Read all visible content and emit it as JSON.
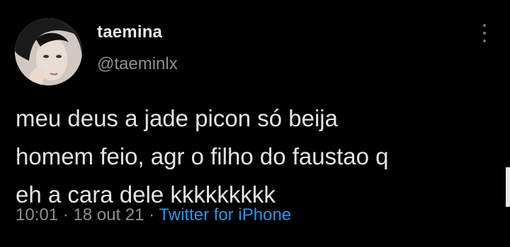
{
  "tweet": {
    "author": {
      "display_name": "taemina",
      "handle": "@taeminlx"
    },
    "text_lines": [
      "meu deus a jade picon só beija",
      "homem feio, agr o filho do faustao q",
      "eh a cara dele kkkkkkkkk"
    ],
    "time": "10:01",
    "date": "18 out 21",
    "separator": "·",
    "source": "Twitter for iPhone"
  },
  "colors": {
    "background": "#000000",
    "text": "#e3e5e6",
    "secondary": "#8b8f93",
    "link": "#1d9bf0"
  }
}
